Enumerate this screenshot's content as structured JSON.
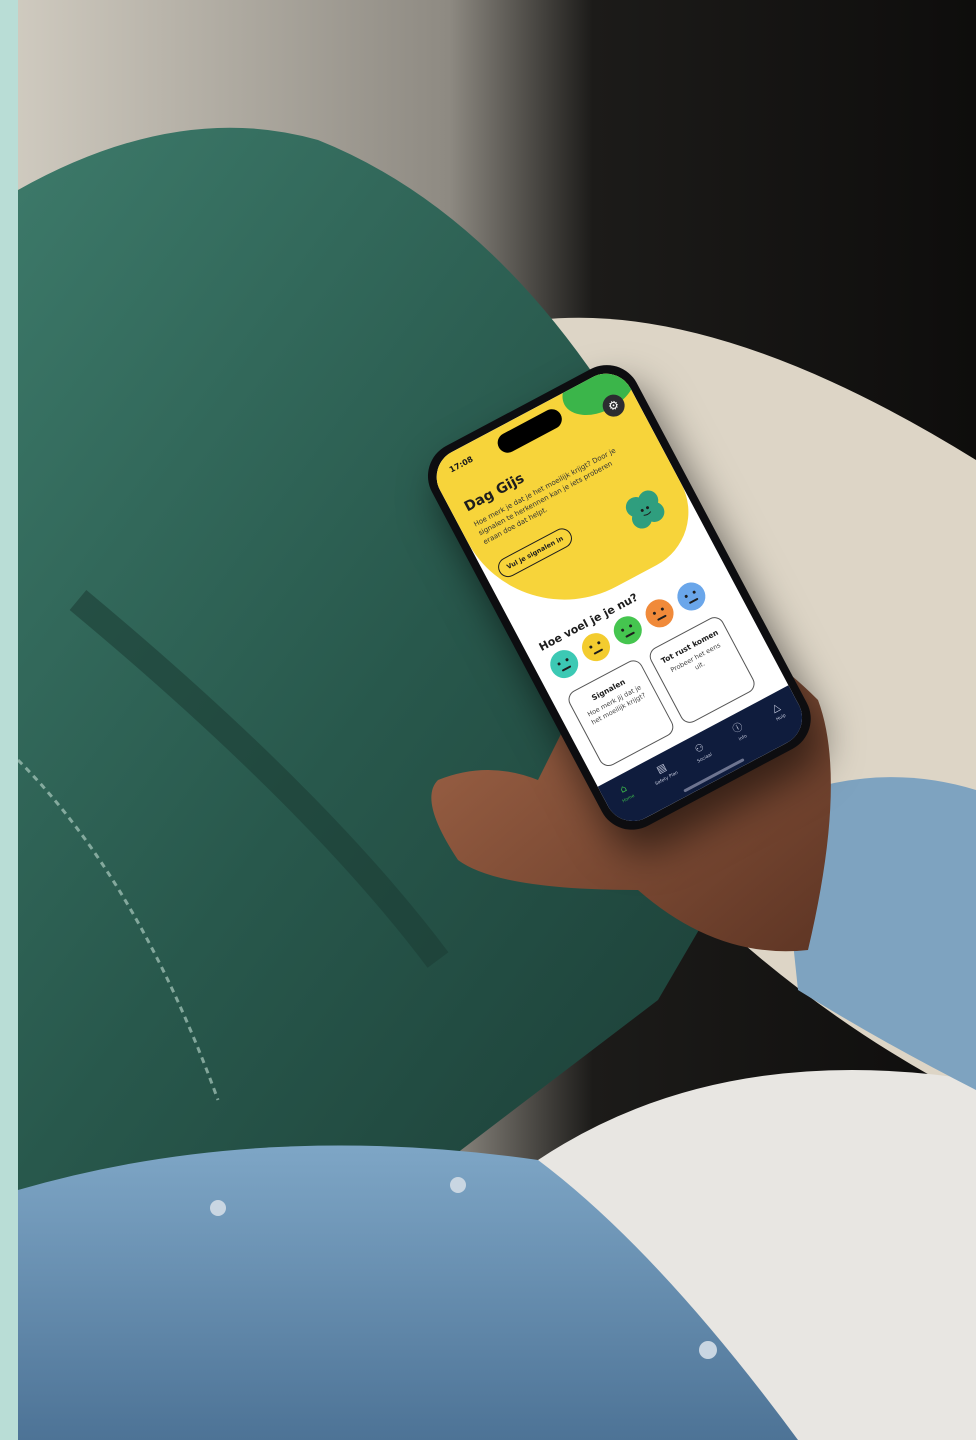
{
  "colors": {
    "page_border": "#b9ddd6",
    "app_yellow": "#f7d43a",
    "app_green": "#3bb54a",
    "tabbar_navy": "#0f1c3d"
  },
  "phone": {
    "status_time": "17:08",
    "greeting": "Dag Gijs",
    "intro_text": "Hoe merk je dat je het moeilijk krijgt? Door je signalen te herkennen kan je iets proberen eraan doe dat helpt.",
    "signal_button": "Vul je signalen in",
    "mood_question": "Hoe voel je je nu?",
    "moods": [
      {
        "name": "happy",
        "color": "#3cc9b4"
      },
      {
        "name": "neutral",
        "color": "#f3cc2f"
      },
      {
        "name": "ok",
        "color": "#45c54f"
      },
      {
        "name": "sad",
        "color": "#f08a3a"
      },
      {
        "name": "down",
        "color": "#6aa6ea"
      }
    ],
    "cards": [
      {
        "title": "Signalen",
        "text": "Hoe merk jij dat je het moeilijk krijgt?"
      },
      {
        "title": "Tot rust komen",
        "text": "Probeer het eens uit."
      }
    ],
    "tabs": [
      {
        "label": "Home",
        "icon": "home-icon",
        "glyph": "⌂",
        "active": true
      },
      {
        "label": "Safety Plan",
        "icon": "book-icon",
        "glyph": "▤",
        "active": false
      },
      {
        "label": "Sociaal",
        "icon": "people-icon",
        "glyph": "⚇",
        "active": false
      },
      {
        "label": "Info",
        "icon": "info-icon",
        "glyph": "ⓘ",
        "active": false
      },
      {
        "label": "Hulp",
        "icon": "alert-icon",
        "glyph": "△",
        "active": false
      }
    ]
  }
}
